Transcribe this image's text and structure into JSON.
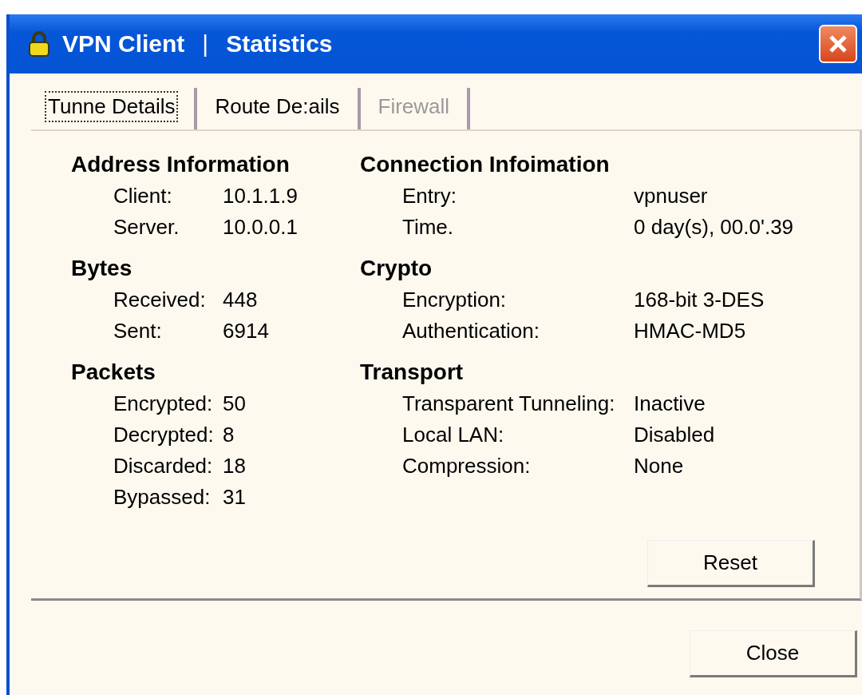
{
  "window": {
    "title": "VPN Client",
    "separator": "|",
    "subtitle": "Statistics"
  },
  "tabs": [
    {
      "label": "Tunne Details",
      "selected": true,
      "disabled": false
    },
    {
      "label": "Route De:ails",
      "selected": false,
      "disabled": false
    },
    {
      "label": "Firewall",
      "selected": false,
      "disabled": true
    }
  ],
  "left_sections": [
    {
      "heading": "Address Information",
      "rows": [
        {
          "label": "Client:",
          "value": "10.1.1.9"
        },
        {
          "label": "Server.",
          "value": "10.0.0.1"
        }
      ]
    },
    {
      "heading": "Bytes",
      "rows": [
        {
          "label": "Received:",
          "value": "448"
        },
        {
          "label": "Sent:",
          "value": "6914"
        }
      ]
    },
    {
      "heading": "Packets",
      "rows": [
        {
          "label": "Encrypted:",
          "value": "50"
        },
        {
          "label": "Decrypted:",
          "value": "8"
        },
        {
          "label": "Discarded:",
          "value": "18"
        },
        {
          "label": "Bypassed:",
          "value": "31"
        }
      ]
    }
  ],
  "right_sections": [
    {
      "heading": "Connection Infoimation",
      "rows": [
        {
          "label": "Entry:",
          "value": "vpnuser"
        },
        {
          "label": "Time.",
          "value": "0 day(s), 00.0'.39"
        }
      ]
    },
    {
      "heading": "Crypto",
      "rows": [
        {
          "label": "Encryption:",
          "value": "168-bit 3-DES"
        },
        {
          "label": "Authentication:",
          "value": "HMAC-MD5"
        }
      ]
    },
    {
      "heading": "Transport",
      "rows": [
        {
          "label": "Transparent Tunneling:",
          "value": "Inactive"
        },
        {
          "label": "Local LAN:",
          "value": "Disabled"
        },
        {
          "label": "Compression:",
          "value": "None"
        }
      ]
    }
  ],
  "reset_button": "Reset",
  "close_button": "Close"
}
